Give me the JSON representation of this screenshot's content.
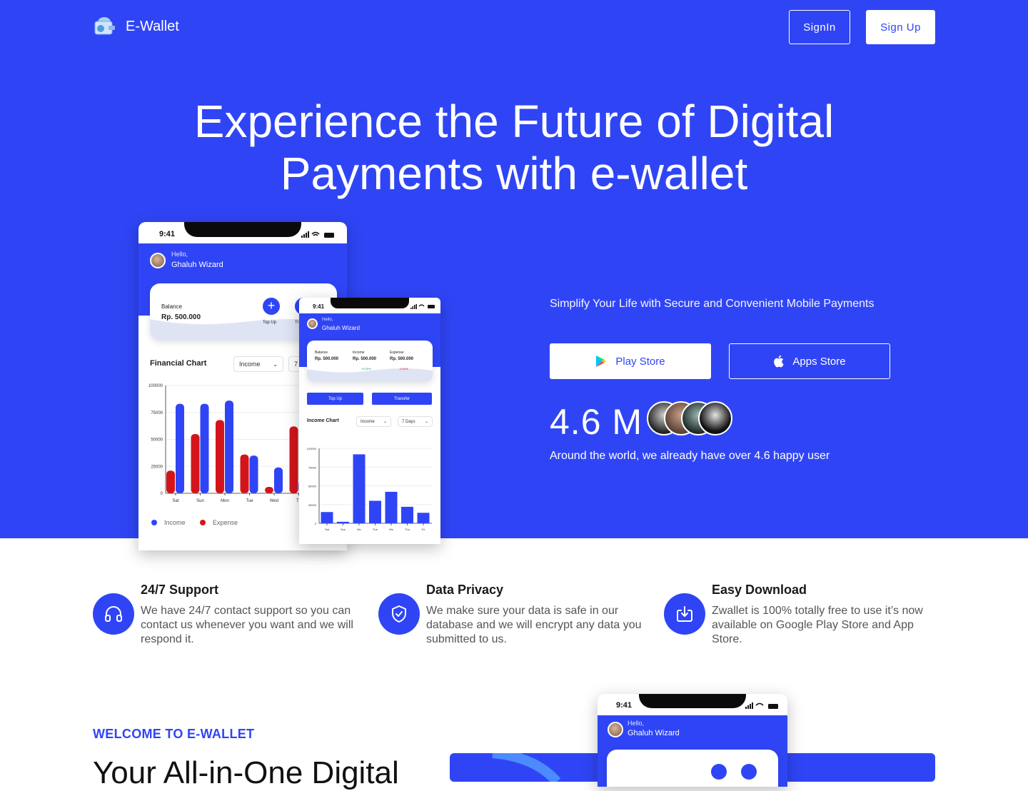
{
  "nav": {
    "brand": "E-Wallet",
    "signin_label": "SignIn",
    "signup_label": "Sign Up"
  },
  "hero": {
    "title_line1": "Experience the Future of Digital",
    "title_line2": "Payments with e-wallet",
    "subtitle": "Simplify Your Life with Secure and Convenient Mobile Payments",
    "play_store_label": "Play Store",
    "apps_store_label": "Apps Store",
    "users_count": "4.6 M",
    "users_text": "Around the world, we already have over 4.6 happy user"
  },
  "phone_large": {
    "time": "9:41",
    "hello": "Hello,",
    "name": "Ghaluh Wizard",
    "balance_label": "Balance",
    "balance_value": "Rp. 500.000",
    "top_up": "Top Up",
    "tr_partial": "Tr",
    "chart_title": "Financial Chart",
    "dropdown_value": "Income",
    "dropdown2_partial": "7",
    "y_ticks": [
      "100000",
      "75000",
      "50000",
      "25000",
      "0"
    ],
    "x_ticks": [
      "Sat",
      "Sun",
      "Mon",
      "Tue",
      "Wed",
      "Th"
    ],
    "legend_income": "Income",
    "legend_expense": "Expense"
  },
  "phone_small": {
    "time": "9:41",
    "hello": "Hello,",
    "name": "Ghaluh Wizard",
    "balance_label": "Balance",
    "balance_value": "Rp. 500.000",
    "income_label": "Income",
    "income_value": "Rp. 500.000",
    "income_change": "+5.00%",
    "expense_label": "Expense",
    "expense_value": "Rp. 500.000",
    "expense_change": "-5.00%",
    "top_up": "Top Up",
    "transfer": "Transfer",
    "chart_title": "Income Chart",
    "dropdown_value": "Income",
    "dropdown2_value": "7 Days",
    "y_ticks": [
      "100000",
      "75000",
      "50000",
      "25000",
      "0"
    ],
    "x_ticks": [
      "Sat",
      "Sun",
      "Mo",
      "Tue",
      "We",
      "Thu",
      "Fri"
    ]
  },
  "phone_bottom": {
    "time": "9:41",
    "hello": "Hello,",
    "name": "Ghaluh Wizard"
  },
  "features": [
    {
      "title": "24/7 Support",
      "desc": "We have 24/7 contact support so you can contact us whenever you want and we will respond it.",
      "icon": "headphones-icon"
    },
    {
      "title": "Data Privacy",
      "desc": "We make sure your data is safe in our database and we will encrypt any data you submitted to us.",
      "icon": "shield-check-icon"
    },
    {
      "title": "Easy Download",
      "desc": "Zwallet is 100% totally free to use it’s now available on Google Play Store and App Store.",
      "icon": "download-icon"
    }
  ],
  "welcome": {
    "eyebrow": "WELCOME TO E-WALLET",
    "heading": "Your All-in-One Digital"
  },
  "colors": {
    "primary": "#2f45f5",
    "expense": "#d3151b",
    "white": "#ffffff"
  },
  "chart_data": [
    {
      "type": "bar",
      "title": "Financial Chart",
      "categories": [
        "Sat",
        "Sun",
        "Mon",
        "Tue",
        "Wed",
        "Th"
      ],
      "series": [
        {
          "name": "Income",
          "values": [
            83000,
            83000,
            86000,
            35000,
            24000,
            12000
          ]
        },
        {
          "name": "Expense",
          "values": [
            21000,
            55000,
            68000,
            36000,
            6000,
            62000
          ]
        }
      ],
      "ylim": [
        0,
        100000
      ],
      "legend": "bottom-left"
    },
    {
      "type": "bar",
      "title": "Income Chart",
      "categories": [
        "Sat",
        "Sun",
        "Mo",
        "Tue",
        "We",
        "Thu",
        "Fri"
      ],
      "series": [
        {
          "name": "Income",
          "values": [
            15000,
            2000,
            92000,
            30000,
            42000,
            22000,
            14000
          ]
        }
      ],
      "ylim": [
        0,
        100000
      ]
    }
  ]
}
